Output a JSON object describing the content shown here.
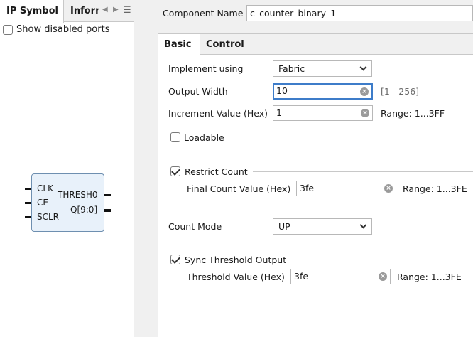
{
  "left": {
    "tabs": [
      "IP Symbol",
      "Inforn"
    ],
    "nav_left": "◀",
    "nav_right": "▶",
    "menu": "☰",
    "show_disabled": "Show disabled ports",
    "symbol": {
      "inputs": [
        "CLK",
        "CE",
        "SCLR"
      ],
      "outputs": [
        "THRESH0",
        "Q[9:0]"
      ]
    }
  },
  "component": {
    "label": "Component Name",
    "value": "c_counter_binary_1"
  },
  "tabs": {
    "basic": "Basic",
    "control": "Control"
  },
  "basic": {
    "implement": {
      "label": "Implement using",
      "value": "Fabric"
    },
    "output_width": {
      "label": "Output Width",
      "value": "10",
      "hint": "[1 - 256]"
    },
    "increment": {
      "label": "Increment Value (Hex)",
      "value": "1",
      "hint": "Range: 1...3FF"
    },
    "loadable": {
      "label": "Loadable",
      "checked": false
    },
    "restrict": {
      "label": "Restrict Count",
      "checked": true
    },
    "final_count": {
      "label": "Final Count Value (Hex)",
      "value": "3fe",
      "hint": "Range: 1...3FE"
    },
    "count_mode": {
      "label": "Count Mode",
      "value": "UP"
    },
    "sync": {
      "label": "Sync Threshold Output",
      "checked": true
    },
    "threshold": {
      "label": "Threshold Value (Hex)",
      "value": "3fe",
      "hint": "Range: 1...3FE"
    }
  },
  "clear_glyph": "×"
}
